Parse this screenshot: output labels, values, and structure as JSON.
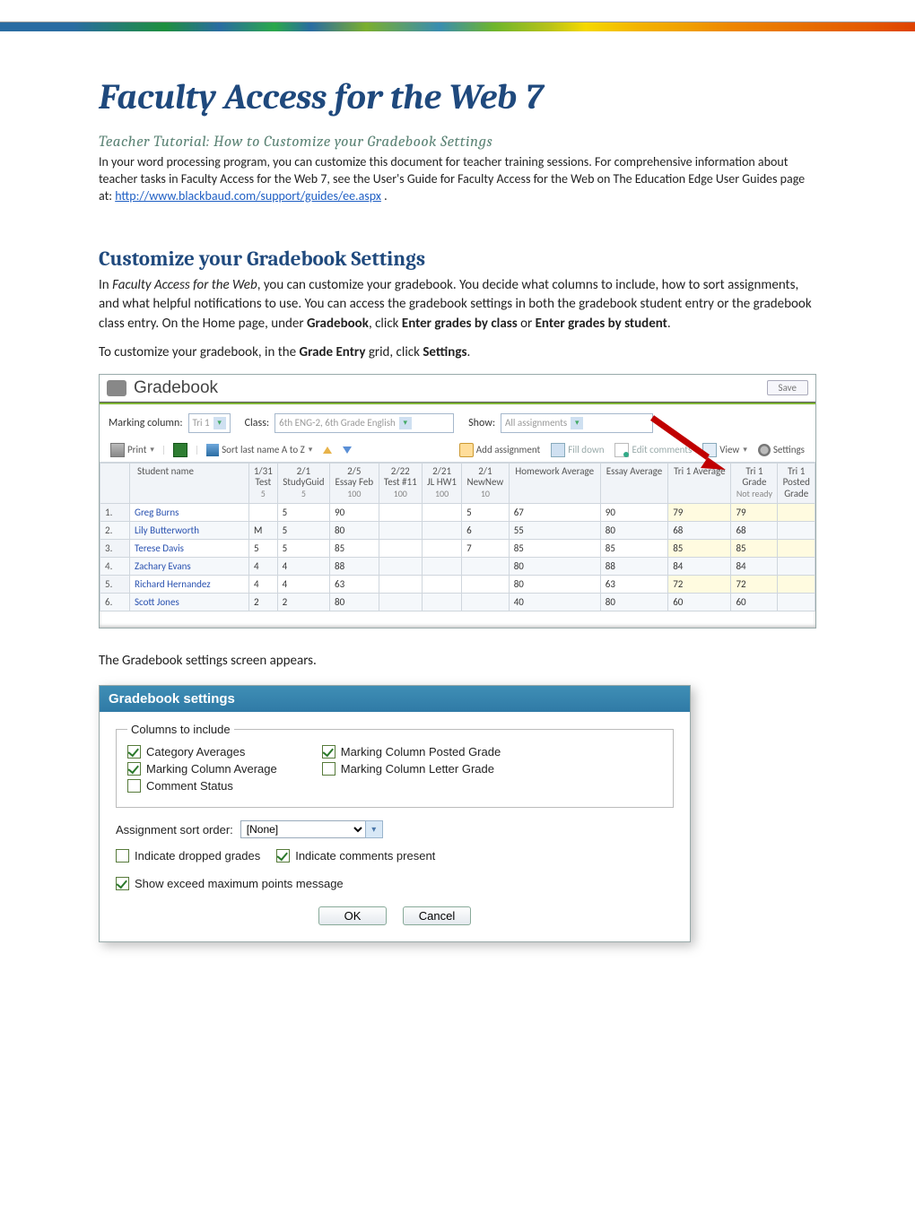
{
  "doc": {
    "title": "Faculty Access for the Web 7",
    "subtitle": "Teacher Tutorial: How to Customize your Gradebook Settings",
    "intro1": "In your word processing program, you can customize this document for teacher training sessions. For comprehensive information about teacher tasks in Faculty Access for the Web 7, see the User's Guide for Faculty Access for the Web on The Education Edge User Guides page at: ",
    "intro_link": "http://www.blackbaud.com/support/guides/ee.aspx",
    "intro_period": ".",
    "section": "Customize your Gradebook Settings",
    "p1a": "In ",
    "p1b": "Faculty Access for the Web",
    "p1c": ", you can customize your gradebook. You decide what columns to include, how to sort assignments, and what helpful notifications to use. You can access the gradebook settings in both the gradebook student entry or the gradebook class entry. On the Home page, under ",
    "p1d": "Gradebook",
    "p1e": ", click  ",
    "p1f": "Enter grades by class",
    "p1g": " or ",
    "p1h": "Enter grades by student",
    "p1i": ".",
    "p2a": "To customize your gradebook, in the ",
    "p2b": "Grade Entry",
    "p2c": " grid, click ",
    "p2d": "Settings",
    "p2e": ".",
    "after_shot1": "The Gradebook settings screen appears."
  },
  "gradebook": {
    "title": "Gradebook",
    "save": "Save",
    "filters": {
      "marking_label": "Marking column:",
      "marking_value": "Tri 1",
      "class_label": "Class:",
      "class_value": "6th ENG-2, 6th Grade English",
      "show_label": "Show:",
      "show_value": "All assignments"
    },
    "toolbar": {
      "print": "Print",
      "sort": "Sort last name A to Z",
      "add": "Add assignment",
      "fill": "Fill down",
      "edit": "Edit comments",
      "view": "View",
      "settings": "Settings"
    },
    "headers": {
      "sname": "Student name",
      "c1a": "1/31",
      "c1b": "Test",
      "c1c": "5",
      "c2a": "2/1",
      "c2b": "StudyGuid",
      "c2c": "5",
      "c3a": "2/5",
      "c3b": "Essay Feb",
      "c3c": "100",
      "c4a": "2/22",
      "c4b": "Test #11",
      "c4c": "100",
      "c5a": "2/21",
      "c5b": "JL HW1",
      "c5c": "100",
      "c6a": "2/1",
      "c6b": "NewNew",
      "c6c": "10",
      "c7": "Homework Average",
      "c8": "Essay Average",
      "c9": "Tri 1 Average",
      "c10a": "Tri 1",
      "c10b": "Grade",
      "c10c": "Not ready",
      "c11a": "Tri 1",
      "c11b": "Posted",
      "c11c": "Grade"
    },
    "rows": [
      {
        "n": "1.",
        "name": "Greg Burns",
        "v": [
          "",
          "5",
          "90",
          "",
          "",
          "5",
          "67",
          "90",
          "79",
          "79",
          ""
        ]
      },
      {
        "n": "2.",
        "name": "Lily Butterworth",
        "v": [
          "M",
          "5",
          "80",
          "",
          "",
          "6",
          "55",
          "80",
          "68",
          "68",
          ""
        ]
      },
      {
        "n": "3.",
        "name": "Terese Davis",
        "v": [
          "5",
          "5",
          "85",
          "",
          "",
          "7",
          "85",
          "85",
          "85",
          "85",
          ""
        ]
      },
      {
        "n": "4.",
        "name": "Zachary Evans",
        "v": [
          "4",
          "4",
          "88",
          "",
          "",
          "",
          "80",
          "88",
          "84",
          "84",
          ""
        ]
      },
      {
        "n": "5.",
        "name": "Richard Hernandez",
        "v": [
          "4",
          "4",
          "63",
          "",
          "",
          "",
          "80",
          "63",
          "72",
          "72",
          ""
        ]
      },
      {
        "n": "6.",
        "name": "Scott Jones",
        "v": [
          "2",
          "2",
          "80",
          "",
          "",
          "",
          "40",
          "80",
          "60",
          "60",
          ""
        ]
      }
    ]
  },
  "dialog": {
    "title": "Gradebook settings",
    "legend": "Columns to include",
    "cat_avg": "Category Averages",
    "mc_avg": "Marking Column Average",
    "comment_status": "Comment Status",
    "mc_posted": "Marking Column Posted Grade",
    "mc_letter": "Marking Column Letter Grade",
    "sort_label": "Assignment sort order:",
    "sort_value": "[None]",
    "dropped": "Indicate dropped grades",
    "comments_present": "Indicate comments present",
    "exceed_msg": "Show exceed maximum points message",
    "ok": "OK",
    "cancel": "Cancel"
  }
}
